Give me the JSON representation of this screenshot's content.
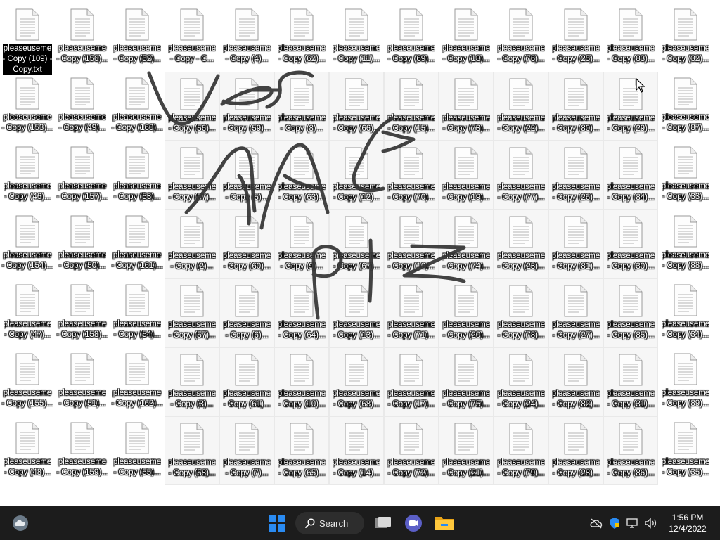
{
  "desktop": {
    "rows": [
      [
        {
          "l1": "pleaseuseme",
          "l2": "- Copy (109) -",
          "l3": "Copy.txt",
          "selected": true
        },
        {
          "l1": "pleaseuseme",
          "l2": "- Copy (156)..."
        },
        {
          "l1": "pleaseuseme",
          "l2": "- Copy (52)..."
        },
        {
          "l1": "pleaseuseme",
          "l2": "- Copy - C..."
        },
        {
          "l1": "pleaseuseme",
          "l2": "- Copy (4)..."
        },
        {
          "l1": "pleaseuseme",
          "l2": "- Copy (62)..."
        },
        {
          "l1": "pleaseuseme",
          "l2": "- Copy (11)..."
        },
        {
          "l1": "pleaseuseme",
          "l2": "- Copy (69)..."
        },
        {
          "l1": "pleaseuseme",
          "l2": "- Copy (18)..."
        },
        {
          "l1": "pleaseuseme",
          "l2": "- Copy (76)..."
        },
        {
          "l1": "pleaseuseme",
          "l2": "- Copy (25)..."
        },
        {
          "l1": "pleaseuseme",
          "l2": "- Copy (83)..."
        },
        {
          "l1": "pleaseuseme",
          "l2": "- Copy (32)..."
        }
      ],
      [
        {
          "l1": "pleaseuseme",
          "l2": "- Copy (153)..."
        },
        {
          "l1": "pleaseuseme",
          "l2": "- Copy (49)..."
        },
        {
          "l1": "pleaseuseme",
          "l2": "- Copy (160)..."
        },
        {
          "l1": "pleaseuseme",
          "l2": "- Copy (56)..."
        },
        {
          "l1": "pleaseuseme",
          "l2": "- Copy (59)..."
        },
        {
          "l1": "pleaseuseme",
          "l2": "- Copy (8)..."
        },
        {
          "l1": "pleaseuseme",
          "l2": "- Copy (66)..."
        },
        {
          "l1": "pleaseuseme",
          "l2": "- Copy (15)..."
        },
        {
          "l1": "pleaseuseme",
          "l2": "- Copy (73)..."
        },
        {
          "l1": "pleaseuseme",
          "l2": "- Copy (22)..."
        },
        {
          "l1": "pleaseuseme",
          "l2": "- Copy (80)..."
        },
        {
          "l1": "pleaseuseme",
          "l2": "- Copy (29)..."
        },
        {
          "l1": "pleaseuseme",
          "l2": "- Copy (87)..."
        }
      ],
      [
        {
          "l1": "pleaseuseme",
          "l2": "- Copy (46)..."
        },
        {
          "l1": "pleaseuseme",
          "l2": "- Copy (157)..."
        },
        {
          "l1": "pleaseuseme",
          "l2": "- Copy (53)..."
        },
        {
          "l1": "pleaseuseme",
          "l2": "- Copy (57)..."
        },
        {
          "l1": "pleaseuseme",
          "l2": "- Copy (5)..."
        },
        {
          "l1": "pleaseuseme",
          "l2": "- Copy (63)..."
        },
        {
          "l1": "pleaseuseme",
          "l2": "- Copy (12)..."
        },
        {
          "l1": "pleaseuseme",
          "l2": "- Copy (70)..."
        },
        {
          "l1": "pleaseuseme",
          "l2": "- Copy (19)..."
        },
        {
          "l1": "pleaseuseme",
          "l2": "- Copy (77)..."
        },
        {
          "l1": "pleaseuseme",
          "l2": "- Copy (26)..."
        },
        {
          "l1": "pleaseuseme",
          "l2": "- Copy (84)..."
        },
        {
          "l1": "pleaseuseme",
          "l2": "- Copy (33)..."
        }
      ],
      [
        {
          "l1": "pleaseuseme",
          "l2": "- Copy (154)..."
        },
        {
          "l1": "pleaseuseme",
          "l2": "- Copy (50)..."
        },
        {
          "l1": "pleaseuseme",
          "l2": "- Copy (161)..."
        },
        {
          "l1": "pleaseuseme",
          "l2": "- Copy (2)..."
        },
        {
          "l1": "pleaseuseme",
          "l2": "- Copy (60)..."
        },
        {
          "l1": "pleaseuseme",
          "l2": "- Copy (9)..."
        },
        {
          "l1": "pleaseuseme",
          "l2": "- Copy (67)..."
        },
        {
          "l1": "pleaseuseme",
          "l2": "- Copy (16)..."
        },
        {
          "l1": "pleaseuseme",
          "l2": "- Copy (74)..."
        },
        {
          "l1": "pleaseuseme",
          "l2": "- Copy (23)..."
        },
        {
          "l1": "pleaseuseme",
          "l2": "- Copy (81)..."
        },
        {
          "l1": "pleaseuseme",
          "l2": "- Copy (30)..."
        },
        {
          "l1": "pleaseuseme",
          "l2": "- Copy (88)..."
        }
      ],
      [
        {
          "l1": "pleaseuseme",
          "l2": "- Copy (47)..."
        },
        {
          "l1": "pleaseuseme",
          "l2": "- Copy (158)..."
        },
        {
          "l1": "pleaseuseme",
          "l2": "- Copy (54)..."
        },
        {
          "l1": "pleaseuseme",
          "l2": "- Copy (57)..."
        },
        {
          "l1": "pleaseuseme",
          "l2": "- Copy (6)..."
        },
        {
          "l1": "pleaseuseme",
          "l2": "- Copy (64)..."
        },
        {
          "l1": "pleaseuseme",
          "l2": "- Copy (13)..."
        },
        {
          "l1": "pleaseuseme",
          "l2": "- Copy (71)..."
        },
        {
          "l1": "pleaseuseme",
          "l2": "- Copy (20)..."
        },
        {
          "l1": "pleaseuseme",
          "l2": "- Copy (78)..."
        },
        {
          "l1": "pleaseuseme",
          "l2": "- Copy (27)..."
        },
        {
          "l1": "pleaseuseme",
          "l2": "- Copy (85)..."
        },
        {
          "l1": "pleaseuseme",
          "l2": "- Copy (34)..."
        }
      ],
      [
        {
          "l1": "pleaseuseme",
          "l2": "- Copy (155)..."
        },
        {
          "l1": "pleaseuseme",
          "l2": "- Copy (51)..."
        },
        {
          "l1": "pleaseuseme",
          "l2": "- Copy (162)..."
        },
        {
          "l1": "pleaseuseme",
          "l2": "- Copy (3)..."
        },
        {
          "l1": "pleaseuseme",
          "l2": "- Copy (61)..."
        },
        {
          "l1": "pleaseuseme",
          "l2": "- Copy (10)..."
        },
        {
          "l1": "pleaseuseme",
          "l2": "- Copy (68)..."
        },
        {
          "l1": "pleaseuseme",
          "l2": "- Copy (17)..."
        },
        {
          "l1": "pleaseuseme",
          "l2": "- Copy (75)..."
        },
        {
          "l1": "pleaseuseme",
          "l2": "- Copy (24)..."
        },
        {
          "l1": "pleaseuseme",
          "l2": "- Copy (82)..."
        },
        {
          "l1": "pleaseuseme",
          "l2": "- Copy (31)..."
        },
        {
          "l1": "pleaseuseme",
          "l2": "- Copy (89)..."
        }
      ],
      [
        {
          "l1": "pleaseuseme",
          "l2": "- Copy (48)..."
        },
        {
          "l1": "pleaseuseme",
          "l2": "- Copy (159)..."
        },
        {
          "l1": "pleaseuseme",
          "l2": "- Copy (55)..."
        },
        {
          "l1": "pleaseuseme",
          "l2": "- Copy (58)..."
        },
        {
          "l1": "pleaseuseme",
          "l2": "- Copy (7)..."
        },
        {
          "l1": "pleaseuseme",
          "l2": "- Copy (65)..."
        },
        {
          "l1": "pleaseuseme",
          "l2": "- Copy (14)..."
        },
        {
          "l1": "pleaseuseme",
          "l2": "- Copy (72)..."
        },
        {
          "l1": "pleaseuseme",
          "l2": "- Copy (21)..."
        },
        {
          "l1": "pleaseuseme",
          "l2": "- Copy (79)..."
        },
        {
          "l1": "pleaseuseme",
          "l2": "- Copy (28)..."
        },
        {
          "l1": "pleaseuseme",
          "l2": "- Copy (86)..."
        },
        {
          "l1": "pleaseuseme",
          "l2": "- Copy (35)..."
        }
      ]
    ],
    "icon_name": "text-document-icon"
  },
  "taskbar": {
    "background": "#1c1c1c",
    "weather_icon": "weather-cloud-icon",
    "start_icon": "windows-start-icon",
    "start_color": "#2a8bf2",
    "search_label": "Search",
    "search_icon": "search-icon",
    "taskview_icon": "task-view-icon",
    "teams_icon": "teams-chat-icon",
    "explorer_icon": "file-explorer-icon",
    "tray": [
      "cloud-offline-icon",
      "security-shield-icon",
      "network-icon",
      "volume-icon"
    ],
    "time": "1:56 PM",
    "date": "12/4/2022"
  }
}
